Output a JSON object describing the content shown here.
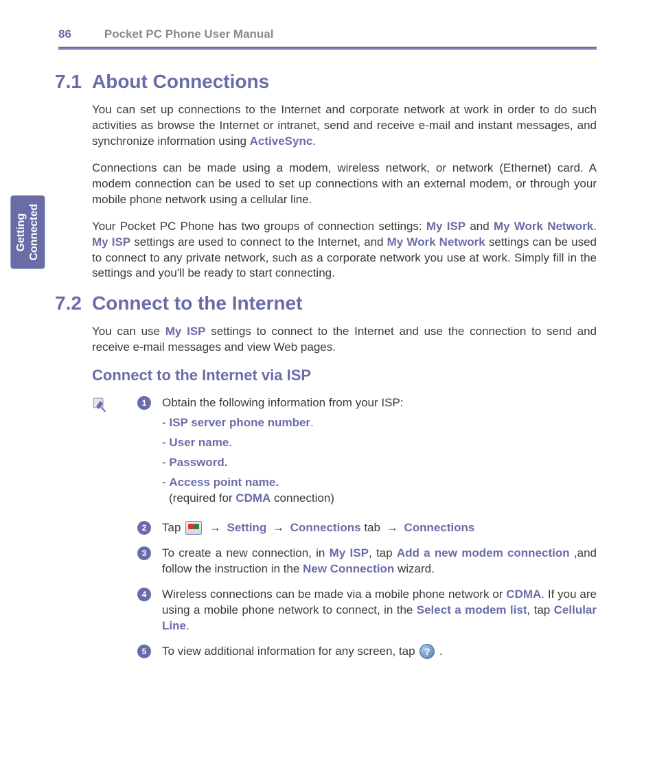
{
  "header": {
    "page_number": "86",
    "manual_title": "Pocket PC Phone User Manual"
  },
  "side_tab": {
    "line1": "Getting",
    "line2": "Connected"
  },
  "sections": {
    "s1": {
      "num": "7.1",
      "title": "About Connections",
      "p1_a": "You can set up connections to the Internet and corporate network at work in order to do such activities as browse the Internet or intranet, send and receive e-mail and instant messages, and synchronize information using ",
      "p1_hl": "ActiveSync",
      "p1_b": ".",
      "p2": "Connections can be made using a modem, wireless network, or network (Ethernet) card. A modem connection can be used to set up connections with an external modem, or through your mobile phone network using a cellular line.",
      "p3_a": "Your Pocket PC Phone has two groups of connection settings: ",
      "p3_hl1": "My ISP",
      "p3_b": " and ",
      "p3_hl2": "My Work Network",
      "p3_c": ". ",
      "p3_hl3": "My ISP",
      "p3_d": " settings are used to connect to the Internet, and ",
      "p3_hl4": "My Work Network",
      "p3_e": " settings can be used to connect to any private network, such as a corporate network you use at work. Simply fill in the settings and you'll be ready to start connecting."
    },
    "s2": {
      "num": "7.2",
      "title": "Connect to the Internet",
      "intro_a": "You can use ",
      "intro_hl": "My ISP",
      "intro_b": " settings to connect to the Internet and use the connection to send and receive e-mail messages and view Web pages.",
      "sub_heading": "Connect to the Internet via ISP",
      "steps": {
        "1": {
          "badge": "1",
          "lead": "Obtain the following information from your ISP:",
          "items": {
            "a": {
              "dash": "- ",
              "hl": "ISP server phone number",
              "tail": "."
            },
            "b": {
              "dash": "- ",
              "hl": "User name",
              "tail": "."
            },
            "c": {
              "dash": "- ",
              "hl": "Password.",
              "tail": ""
            },
            "d": {
              "dash": "- ",
              "hl": "Access point name.",
              "tail": ""
            }
          },
          "note_a": " (required for ",
          "note_hl": "CDMA",
          "note_b": " connection)"
        },
        "2": {
          "badge": "2",
          "a": "Tap ",
          "arrow": " → ",
          "hl1": "Setting",
          "hl2": "Connections",
          "mid": " tab",
          "hl3": "Connections"
        },
        "3": {
          "badge": "3",
          "a": "To create a new connection, in ",
          "hl1": "My ISP",
          "b": ", tap ",
          "hl2": "Add a new modem connection",
          "c": " ,and follow the instruction in the ",
          "hl3": "New Connection",
          "d": " wizard."
        },
        "4": {
          "badge": "4",
          "a": "Wireless connections can be made via a mobile phone network or ",
          "hl1": "CDMA",
          "b": ". If you are using a mobile phone network to connect, in the ",
          "hl2": "Select a modem list",
          "c": ", tap ",
          "hl3": "Cellular Line",
          "d": "."
        },
        "5": {
          "badge": "5",
          "a": "To view additional information for any screen, tap ",
          "help_glyph": "?",
          "b": " ."
        }
      }
    }
  }
}
